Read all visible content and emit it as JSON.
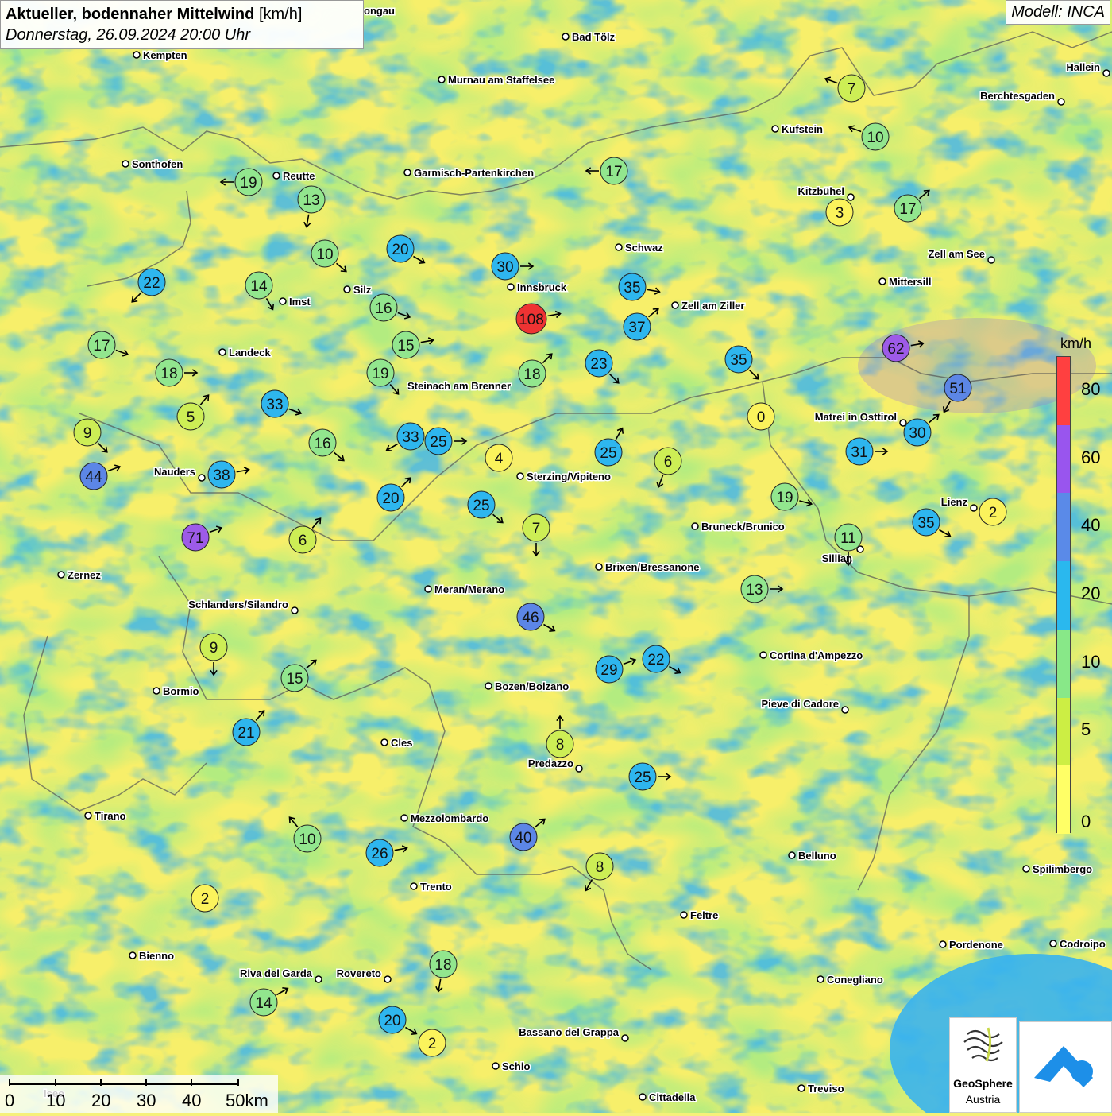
{
  "header": {
    "title_bold": "Aktueller, bodennaher Mittelwind",
    "title_unit": "[km/h]",
    "datetime": "Donnerstag, 26.09.2024 20:00 Uhr",
    "model": "Modell: INCA"
  },
  "legend": {
    "unit": "km/h",
    "ticks": [
      "80",
      "60",
      "40",
      "20",
      "10",
      "5",
      "0"
    ],
    "colors": [
      "#ff4040",
      "#9955ee",
      "#5a8ae8",
      "#2ab8ee",
      "#88e888",
      "#ccee44",
      "#ffff66"
    ]
  },
  "scalebar": {
    "labels": [
      "0",
      "10",
      "20",
      "30",
      "40",
      "50km"
    ]
  },
  "branding": {
    "name_line1": "GeoSphere",
    "name_line2": "Austria"
  },
  "cities": [
    {
      "name": "Kempten"
    },
    {
      "name": "Bad Tölz"
    },
    {
      "name": "Murnau am Staffelsee"
    },
    {
      "name": "Hallein"
    },
    {
      "name": "Berchtesgaden"
    },
    {
      "name": "Kufstein"
    },
    {
      "name": "Sonthofen"
    },
    {
      "name": "Reutte"
    },
    {
      "name": "Garmisch-Partenkirchen"
    },
    {
      "name": "Kitzbühel"
    },
    {
      "name": "Schwaz"
    },
    {
      "name": "Zell am See"
    },
    {
      "name": "Innsbruck"
    },
    {
      "name": "Mittersill"
    },
    {
      "name": "Silz"
    },
    {
      "name": "Imst"
    },
    {
      "name": "Zell am Ziller"
    },
    {
      "name": "Landeck"
    },
    {
      "name": "Steinach am Brenner"
    },
    {
      "name": "Matrei in Osttirol"
    },
    {
      "name": "Nauders"
    },
    {
      "name": "Sterzing/Vipiteno"
    },
    {
      "name": "Lienz"
    },
    {
      "name": "Bruneck/Brunico"
    },
    {
      "name": "Sillian"
    },
    {
      "name": "Brixen/Bressanone"
    },
    {
      "name": "Zernez"
    },
    {
      "name": "Meran/Merano"
    },
    {
      "name": "Schlanders/Silandro"
    },
    {
      "name": "Cortina d'Ampezzo"
    },
    {
      "name": "Bormio"
    },
    {
      "name": "Bozen/Bolzano"
    },
    {
      "name": "Pieve di Cadore"
    },
    {
      "name": "Cles"
    },
    {
      "name": "Predazzo"
    },
    {
      "name": "Tirano"
    },
    {
      "name": "Mezzolombardo"
    },
    {
      "name": "Belluno"
    },
    {
      "name": "Spilimbergo"
    },
    {
      "name": "Trento"
    },
    {
      "name": "Feltre"
    },
    {
      "name": "Bienno"
    },
    {
      "name": "Pordenone"
    },
    {
      "name": "Codroipo"
    },
    {
      "name": "Riva del Garda"
    },
    {
      "name": "Rovereto"
    },
    {
      "name": "Conegliano"
    },
    {
      "name": "Bassano del Grappa"
    },
    {
      "name": "Schio"
    },
    {
      "name": "Treviso"
    },
    {
      "name": "Cittadella"
    },
    {
      "name": "ongau"
    },
    {
      "name": "Iseo"
    }
  ],
  "stations": [
    {
      "value": "7"
    },
    {
      "value": "10"
    },
    {
      "value": "17"
    },
    {
      "value": "19"
    },
    {
      "value": "13"
    },
    {
      "value": "3"
    },
    {
      "value": "17"
    },
    {
      "value": "10"
    },
    {
      "value": "20"
    },
    {
      "value": "30"
    },
    {
      "value": "22"
    },
    {
      "value": "14"
    },
    {
      "value": "35"
    },
    {
      "value": "16"
    },
    {
      "value": "108"
    },
    {
      "value": "37"
    },
    {
      "value": "15"
    },
    {
      "value": "62"
    },
    {
      "value": "17"
    },
    {
      "value": "18"
    },
    {
      "value": "19"
    },
    {
      "value": "18"
    },
    {
      "value": "23"
    },
    {
      "value": "35"
    },
    {
      "value": "51"
    },
    {
      "value": "33"
    },
    {
      "value": "5"
    },
    {
      "value": "33"
    },
    {
      "value": "0"
    },
    {
      "value": "30"
    },
    {
      "value": "9"
    },
    {
      "value": "33"
    },
    {
      "value": "25"
    },
    {
      "value": "16"
    },
    {
      "value": "4"
    },
    {
      "value": "25"
    },
    {
      "value": "6"
    },
    {
      "value": "31"
    },
    {
      "value": "44"
    },
    {
      "value": "38"
    },
    {
      "value": "20"
    },
    {
      "value": "19"
    },
    {
      "value": "25"
    },
    {
      "value": "2"
    },
    {
      "value": "7"
    },
    {
      "value": "35"
    },
    {
      "value": "71"
    },
    {
      "value": "6"
    },
    {
      "value": "11"
    },
    {
      "value": "13"
    },
    {
      "value": "46"
    },
    {
      "value": "9"
    },
    {
      "value": "29"
    },
    {
      "value": "22"
    },
    {
      "value": "15"
    },
    {
      "value": "21"
    },
    {
      "value": "8"
    },
    {
      "value": "25"
    },
    {
      "value": "10"
    },
    {
      "value": "40"
    },
    {
      "value": "26"
    },
    {
      "value": "8"
    },
    {
      "value": "2"
    },
    {
      "value": "18"
    },
    {
      "value": "14"
    },
    {
      "value": "20"
    },
    {
      "value": "2"
    }
  ]
}
